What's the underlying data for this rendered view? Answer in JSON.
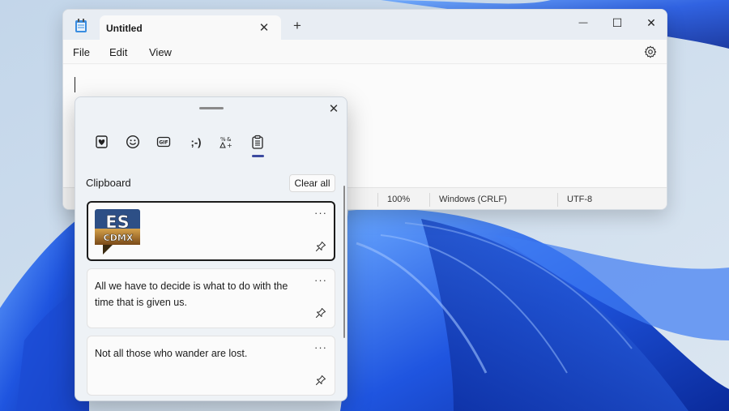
{
  "notepad": {
    "tab_title": "Untitled",
    "tab_close": "✕",
    "new_tab": "+",
    "window_controls": {
      "minimize": "—",
      "maximize": "☐",
      "close": "✕"
    },
    "menu": {
      "file": "File",
      "edit": "Edit",
      "view": "View"
    },
    "status": {
      "zoom": "100%",
      "line_ending": "Windows (CRLF)",
      "encoding": "UTF-8"
    }
  },
  "panel": {
    "close": "✕",
    "categories": [
      {
        "name": "favorites",
        "icon": "heart-note-icon"
      },
      {
        "name": "emoji",
        "icon": "smiley-icon"
      },
      {
        "name": "gif",
        "icon": "gif-icon"
      },
      {
        "name": "kaomoji",
        "label": ";-)"
      },
      {
        "name": "symbols",
        "icon": "symbols-icon"
      },
      {
        "name": "clipboard",
        "icon": "clipboard-icon",
        "active": true
      }
    ],
    "section_title": "Clipboard",
    "clear_all": "Clear all",
    "items": [
      {
        "type": "image",
        "logo_text": [
          "ES",
          "CDMX"
        ],
        "more": "···"
      },
      {
        "type": "text",
        "text": "All we have to decide is what to do with the time that is given us.",
        "more": "···"
      },
      {
        "type": "text",
        "text": "Not all those who wander are lost.",
        "more": "···"
      }
    ]
  },
  "colors": {
    "accent": "#3b4aa0",
    "wallpaper_blue": "#1f4fd6"
  }
}
